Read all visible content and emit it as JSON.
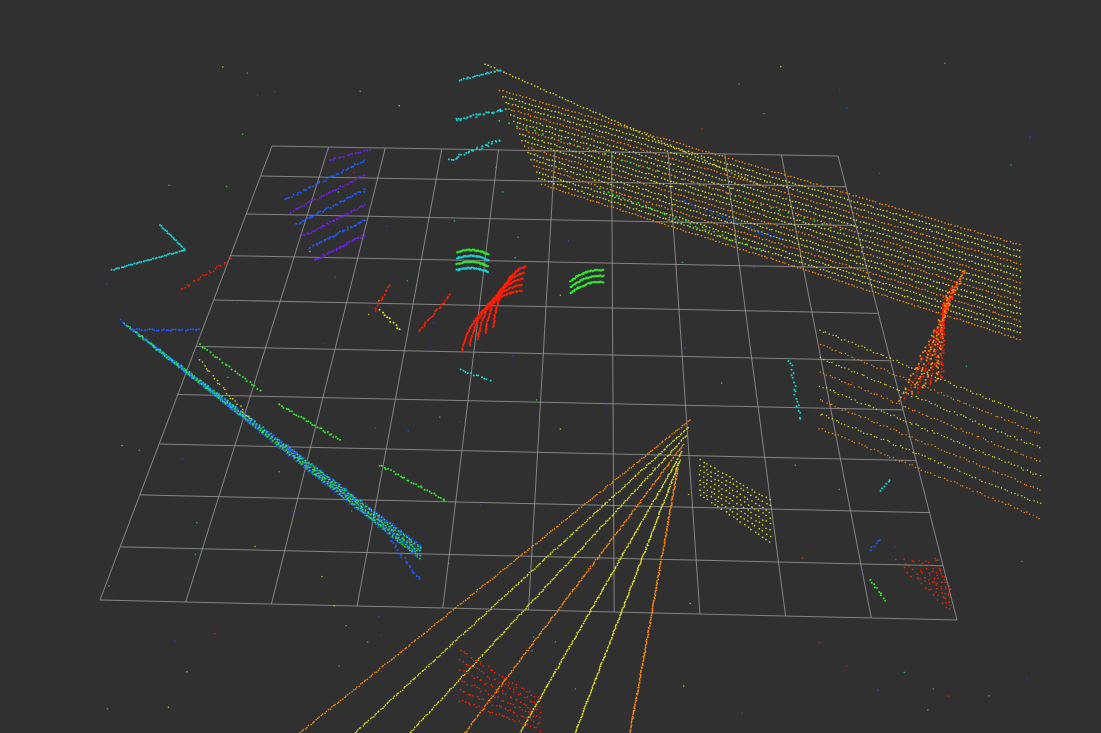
{
  "viewer": {
    "background_color": "#303030",
    "grid_color": "#9a9a9a",
    "grid_cells": 10,
    "colormap": [
      "#ff1e00",
      "#ff8c00",
      "#e3e31c",
      "#2ee82e",
      "#16d2d2",
      "#1e5aff",
      "#6e1ee6"
    ]
  }
}
